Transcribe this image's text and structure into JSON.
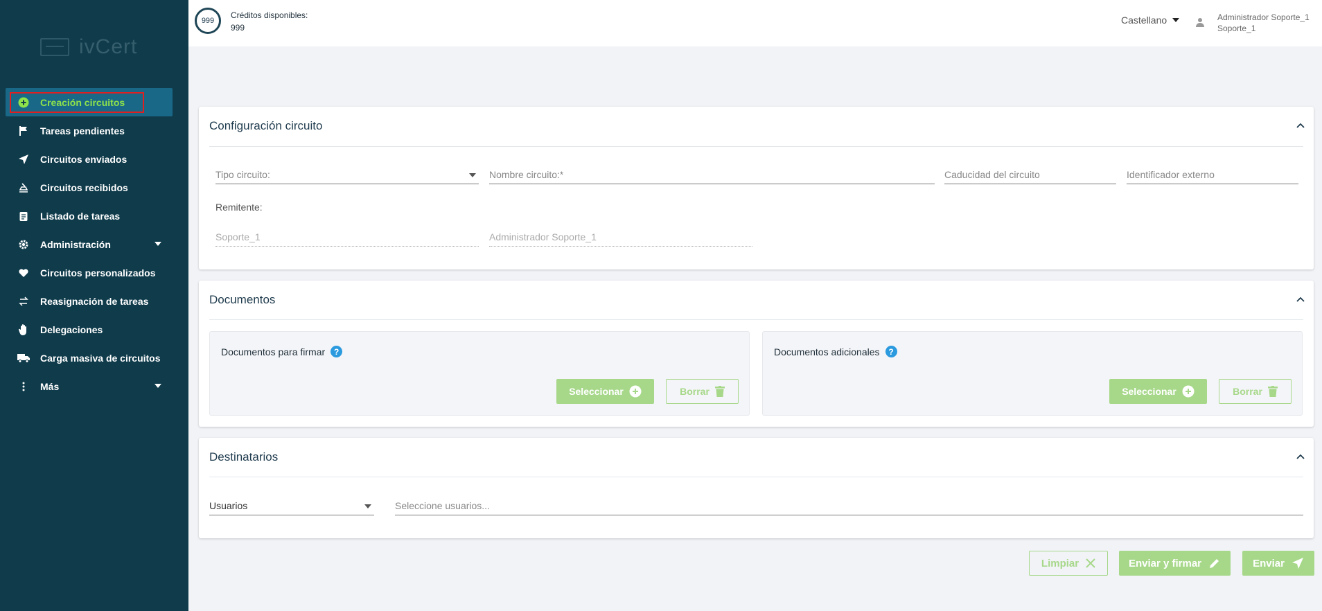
{
  "logo": {
    "text": "ivCert"
  },
  "sidebar": {
    "items": [
      {
        "label": "Creación circuitos",
        "icon": "plus-circle-icon"
      },
      {
        "label": "Tareas pendientes",
        "icon": "flag-icon"
      },
      {
        "label": "Circuitos enviados",
        "icon": "send-icon"
      },
      {
        "label": "Circuitos recibidos",
        "icon": "inbox-icon"
      },
      {
        "label": "Listado de tareas",
        "icon": "clipboard-icon"
      },
      {
        "label": "Administración",
        "icon": "gear-icon"
      },
      {
        "label": "Circuitos personalizados",
        "icon": "heart-icon"
      },
      {
        "label": "Reasignación de tareas",
        "icon": "swap-icon"
      },
      {
        "label": "Delegaciones",
        "icon": "hand-icon"
      },
      {
        "label": "Carga masiva de circuitos",
        "icon": "truck-icon"
      },
      {
        "label": "Más",
        "icon": "more-vertical-icon"
      }
    ]
  },
  "header": {
    "credits_badge": "999",
    "credits_label": "Créditos disponibles:",
    "credits_value": "999",
    "language": "Castellano",
    "user_name": "Administrador Soporte_1",
    "user_login": "Soporte_1"
  },
  "config": {
    "title": "Configuración circuito",
    "tipo_placeholder": "Tipo circuito:",
    "nombre_placeholder": "Nombre circuito:*",
    "caducidad_placeholder": "Caducidad del circuito",
    "identificador_placeholder": "Identificador externo",
    "remitente_label": "Remitente:",
    "remitente_login": "Soporte_1",
    "remitente_name": "Administrador Soporte_1"
  },
  "documentos": {
    "title": "Documentos",
    "firmar_title": "Documentos para firmar",
    "adicionales_title": "Documentos adicionales",
    "help": "?",
    "select_label": "Seleccionar",
    "delete_label": "Borrar"
  },
  "destinatarios": {
    "title": "Destinatarios",
    "type_value": "Usuarios",
    "users_placeholder": "Seleccione usuarios..."
  },
  "actions": {
    "limpiar": "Limpiar",
    "enviar_firmar": "Enviar y firmar",
    "enviar": "Enviar"
  },
  "colors": {
    "sidebar": "#0f3b4b",
    "active": "#1a6888",
    "accent_green": "#8ee34a",
    "button_green": "#a7d88a",
    "highlight": "#e02020",
    "help_blue": "#2b9adf"
  }
}
